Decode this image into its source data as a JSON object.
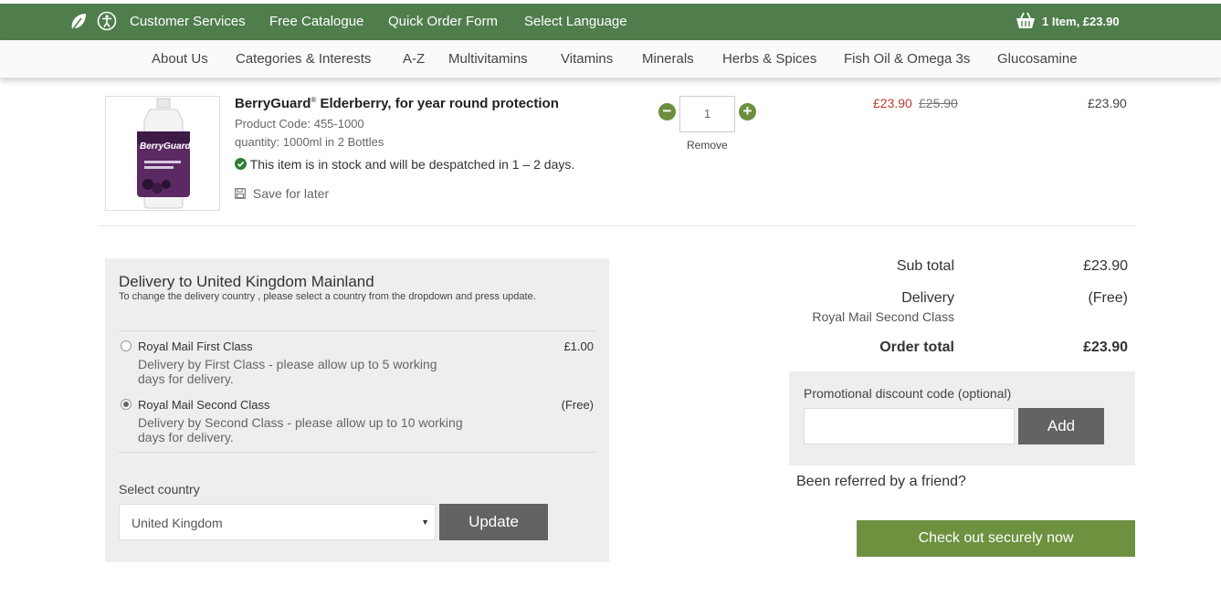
{
  "colors": {
    "topbar": "#4f7e4c",
    "checkout": "#6e9140",
    "sale_price": "#c0392b",
    "button_grey": "#636363"
  },
  "topbar": {
    "icons": [
      "leaf-icon",
      "accessibility-icon",
      "basket-icon"
    ],
    "links": [
      "Customer Services",
      "Free Catalogue",
      "Quick Order Form",
      "Select Language"
    ],
    "basket": "1 Item, £23.90"
  },
  "nav": {
    "items": [
      "About Us",
      "Categories & Interests",
      "A-Z",
      "Multivitamins",
      "Vitamins",
      "Minerals",
      "Herbs & Spices",
      "Fish Oil & Omega 3s",
      "Glucosamine"
    ]
  },
  "product": {
    "brand": "BerryGuard",
    "reg": "®",
    "title_rest": " Elderberry, for year round protection",
    "code": "Product Code: 455-1000",
    "quantity_info": "quantity: 1000ml in 2 Bottles",
    "stock": "This item is in stock and will be despatched in 1 – 2 days.",
    "save_for_later": "Save for later",
    "bottle_label": "BerryGuard",
    "qty": "1",
    "remove": "Remove",
    "price": "£23.90",
    "was_price": "£25.90",
    "line_total": "£23.90"
  },
  "delivery": {
    "title": "Delivery to United Kingdom Mainland",
    "subtitle": "To change the delivery country , please select a country from the dropdown and press update.",
    "options": [
      {
        "name": "Royal Mail First Class",
        "desc": "Delivery by First Class - please allow up to 5 working days for delivery.",
        "price": "£1.00",
        "selected": false
      },
      {
        "name": "Royal Mail Second Class",
        "desc": "Delivery by Second Class - please allow up to 10 working days for delivery.",
        "price": "(Free)",
        "selected": true
      }
    ],
    "select_label": "Select country",
    "country": "United Kingdom",
    "update": "Update"
  },
  "summary": {
    "subtotal_label": "Sub total",
    "subtotal": "£23.90",
    "delivery_label": "Delivery",
    "delivery_value": "(Free)",
    "delivery_method": "Royal Mail Second Class",
    "total_label": "Order total",
    "total": "£23.90"
  },
  "promo": {
    "label": "Promotional discount code (optional)",
    "add": "Add"
  },
  "referred": "Been referred by a friend?",
  "checkout": "Check out securely now"
}
